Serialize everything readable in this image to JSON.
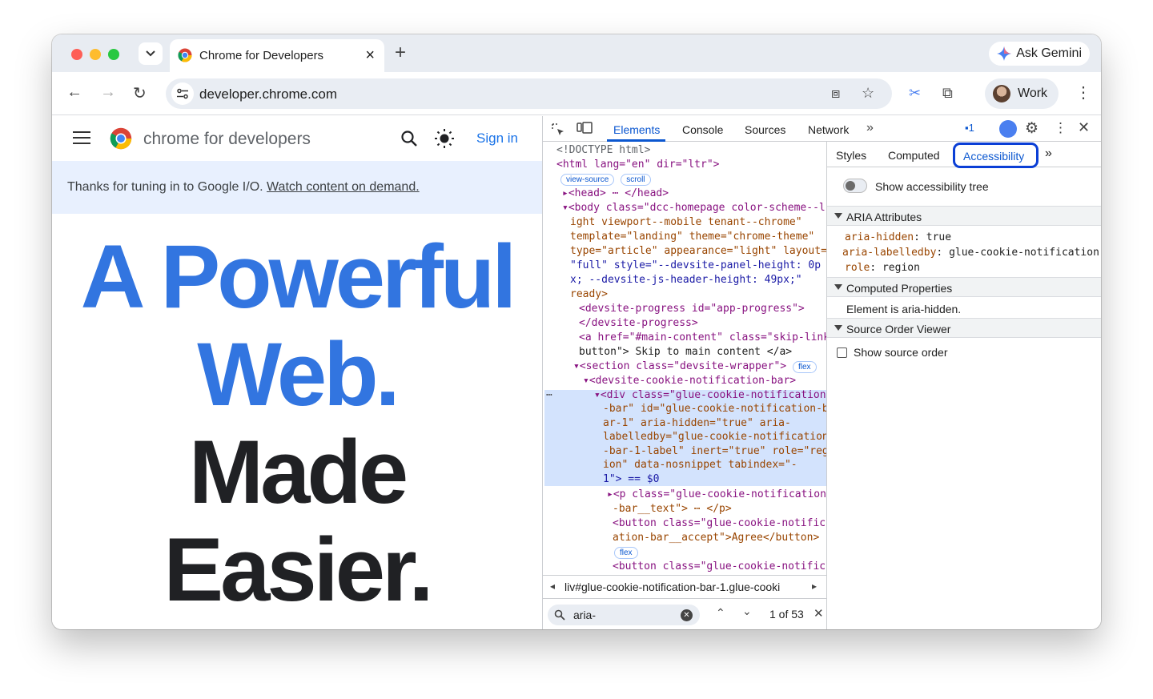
{
  "browser": {
    "tab_title": "Chrome for Developers",
    "gemini_label": "Ask Gemini",
    "url": "developer.chrome.com",
    "profile_label": "Work"
  },
  "site": {
    "title": "chrome for developers",
    "sign_in": "Sign in",
    "banner_text": "Thanks for tuning in to Google I/O. ",
    "banner_link": "Watch content on demand.",
    "hero_line1": "A Powerful",
    "hero_line2": "Web.",
    "hero_line3": "Made",
    "hero_line4": "Easier."
  },
  "devtools": {
    "tabs": [
      "Elements",
      "Console",
      "Sources",
      "Network"
    ],
    "issues_count": "1",
    "side_tabs": [
      "Styles",
      "Computed",
      "Accessibility"
    ],
    "show_tree_label": "Show accessibility tree",
    "aria_section": "ARIA Attributes",
    "aria_attrs": [
      {
        "k": "aria-hidden",
        "v": "true"
      },
      {
        "k": "aria-labelledby",
        "v": "glue-cookie-notification-b"
      },
      {
        "k": "role",
        "v": "region"
      }
    ],
    "computed_section": "Computed Properties",
    "computed_text": "Element is aria-hidden.",
    "source_section": "Source Order Viewer",
    "show_source_label": "Show source order",
    "breadcrumb": "liv#glue-cookie-notification-bar-1.glue-cooki",
    "search_value": "aria-",
    "search_count": "1 of 53",
    "pills": [
      "view-source",
      "scroll",
      "flex",
      "flex"
    ],
    "dom_lines": [
      "<!DOCTYPE html>",
      "<html lang=\"en\" dir=\"ltr\">",
      "<head> ⋯ </head>",
      "<body class=\"dcc-homepage color-scheme--l",
      "ight viewport--mobile tenant--chrome\"",
      "template=\"landing\" theme=\"chrome-theme\"",
      "type=\"article\" appearance=\"light\" layout=",
      "\"full\" style=\"--devsite-panel-height: 0p",
      "x; --devsite-js-header-height: 49px;\"",
      "ready>",
      "<devsite-progress id=\"app-progress\">",
      "</devsite-progress>",
      "<a href=\"#main-content\" class=\"skip-link",
      "button\"> Skip to main content </a>",
      "<section class=\"devsite-wrapper\">",
      "<devsite-cookie-notification-bar>",
      "<div class=\"glue-cookie-notification",
      "-bar\" id=\"glue-cookie-notification-b",
      "ar-1\" aria-hidden=\"true\" aria-",
      "labelledby=\"glue-cookie-notification",
      "-bar-1-label\" inert=\"true\" role=\"reg",
      "ion\" data-nosnippet tabindex=\"-",
      "1\"> == $0",
      "<p class=\"glue-cookie-notification",
      "-bar__text\"> ⋯ </p>",
      "<button class=\"glue-cookie-notific",
      "ation-bar__accept\">Agree</button>",
      "<button class=\"glue-cookie-notific"
    ]
  }
}
